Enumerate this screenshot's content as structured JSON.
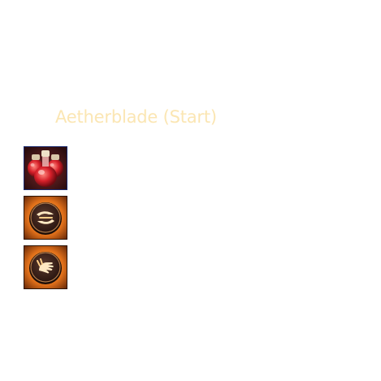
{
  "build": {
    "title": "Aetherblade (Start)"
  },
  "items": [
    {
      "icon": "health-potions-icon"
    },
    {
      "icon": "swift-blade-rune-icon"
    },
    {
      "icon": "warding-hand-rune-icon"
    }
  ],
  "colors": {
    "title_text": "#fbe6b3",
    "background": "#ffffff",
    "rune_orange": "#f08a24",
    "potion_red": "#d6202a"
  }
}
